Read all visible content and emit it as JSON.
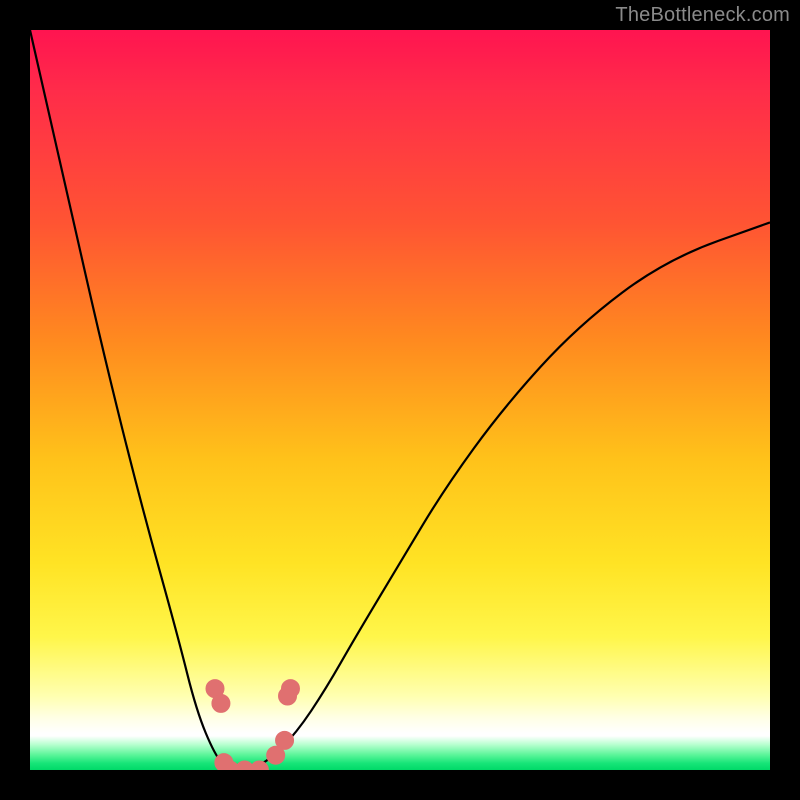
{
  "watermark": {
    "text": "TheBottleneck.com"
  },
  "chart_data": {
    "type": "line",
    "title": "",
    "xlabel": "",
    "ylabel": "",
    "grid": false,
    "legend": null,
    "xlim": [
      0,
      1
    ],
    "ylim": [
      0,
      1
    ],
    "series": [
      {
        "name": "bottleneck-curve",
        "x": [
          0.0,
          0.05,
          0.1,
          0.15,
          0.2,
          0.225,
          0.25,
          0.268,
          0.29,
          0.32,
          0.36,
          0.4,
          0.44,
          0.5,
          0.56,
          0.64,
          0.74,
          0.86,
          1.0
        ],
        "values": [
          1.0,
          0.78,
          0.56,
          0.36,
          0.18,
          0.08,
          0.02,
          0.0,
          0.0,
          0.01,
          0.05,
          0.11,
          0.18,
          0.28,
          0.38,
          0.49,
          0.6,
          0.69,
          0.74
        ]
      },
      {
        "name": "optimal-markers",
        "x": [
          0.25,
          0.258,
          0.262,
          0.27,
          0.29,
          0.31,
          0.332,
          0.344,
          0.348,
          0.352
        ],
        "values": [
          0.11,
          0.09,
          0.01,
          0.0,
          0.0,
          0.0,
          0.02,
          0.04,
          0.1,
          0.11
        ]
      }
    ],
    "background_gradient": {
      "top": "#ff1450",
      "mid_upper": "#ff8a1f",
      "mid": "#ffe324",
      "lower": "#ffffe6",
      "bottom_band": "#00d968"
    }
  }
}
